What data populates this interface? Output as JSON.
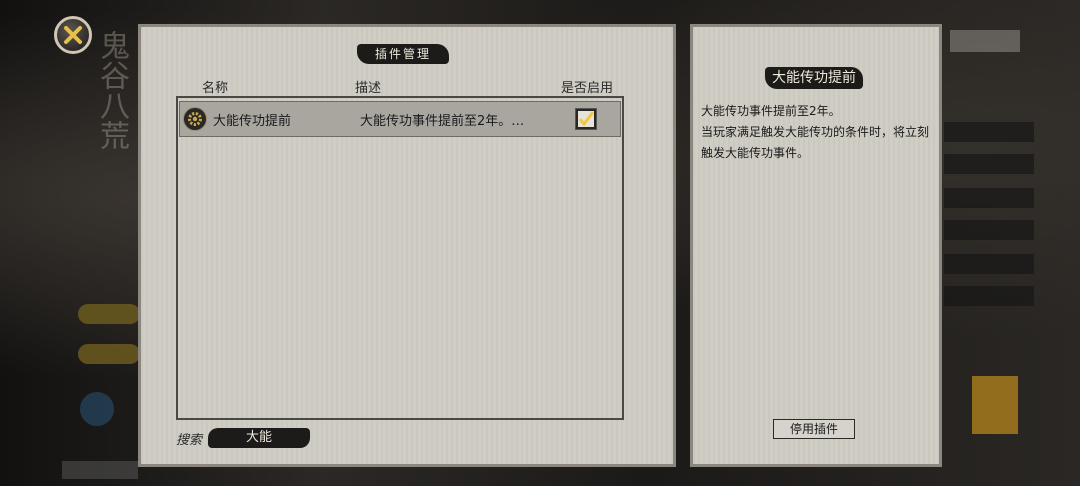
{
  "plugin_panel": {
    "title": "插件管理",
    "columns": {
      "name": "名称",
      "description": "描述",
      "enabled": "是否启用"
    },
    "rows": [
      {
        "name": "大能传功提前",
        "description": "大能传功事件提前至2年。…",
        "enabled": true
      }
    ],
    "search": {
      "label": "搜索",
      "value": "大能"
    }
  },
  "detail_panel": {
    "title": "大能传功提前",
    "lines": [
      "大能传功事件提前至2年。",
      "当玩家满足触发大能传功的条件时，将立刻触发大能传功事件。"
    ],
    "disable_button": "停用插件"
  },
  "colors": {
    "panel_bg": "#cfccc4",
    "badge_bg": "#1c1b1a",
    "badge_text": "#efe9dc",
    "close_x": "#e6c04a",
    "checkmark": "#f2c744"
  },
  "icons": [
    "close-icon",
    "gear-icon",
    "checkmark-icon"
  ]
}
